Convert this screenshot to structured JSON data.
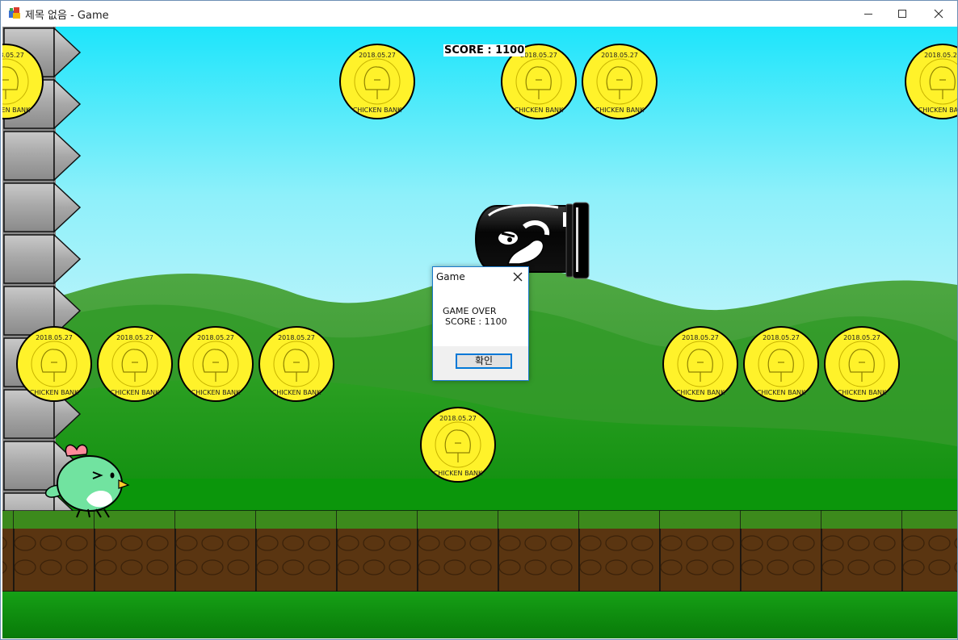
{
  "window": {
    "title": "제목 없음 - Game",
    "icon": "app-icon",
    "controls": {
      "minimize_icon": "minimize-icon",
      "maximize_icon": "maximize-icon",
      "close_icon": "close-icon"
    }
  },
  "game": {
    "score_text": "SCORE : 1100",
    "coin_text_top": "2018.05.27",
    "coin_text_bottom": "CHICKEN BANK",
    "colors": {
      "sky_top": "#1ee6fa",
      "sky_bottom": "#bdf5fb",
      "coin": "#fff22a",
      "grass": "#1f9b14",
      "dirt": "#5a3511"
    }
  },
  "dialog": {
    "title": "Game",
    "message_line1": "GAME OVER",
    "message_line2": "SCORE : 1100",
    "ok_label": "확인"
  }
}
